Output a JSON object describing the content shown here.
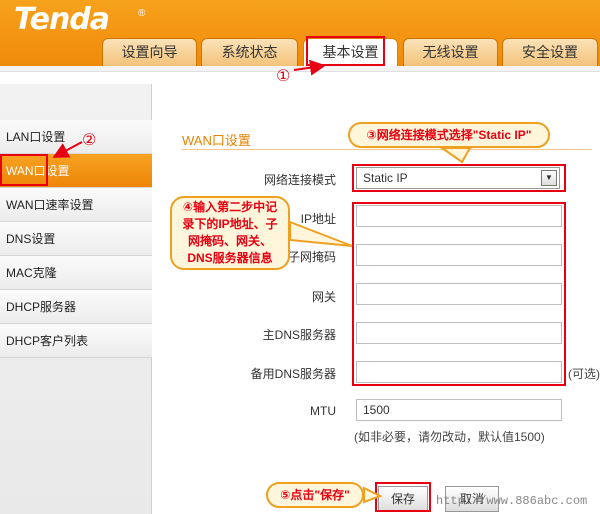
{
  "brand": {
    "logo": "Tenda",
    "reg": "®",
    "accent": "#f08a0a",
    "highlight": "#e60012"
  },
  "tabs": [
    {
      "label": "设置向导"
    },
    {
      "label": "系统状态"
    },
    {
      "label": "基本设置"
    },
    {
      "label": "无线设置"
    },
    {
      "label": "安全设置"
    }
  ],
  "sidebar": {
    "items": [
      {
        "label": "LAN口设置"
      },
      {
        "label": "WAN口设置"
      },
      {
        "label": "WAN口速率设置"
      },
      {
        "label": "DNS设置"
      },
      {
        "label": "MAC克隆"
      },
      {
        "label": "DHCP服务器"
      },
      {
        "label": "DHCP客户列表"
      }
    ]
  },
  "main": {
    "title": "WAN口设置",
    "mode_label": "网络连接模式",
    "mode_value": "Static IP",
    "ip_label": "IP地址",
    "mask_label": "子网掩码",
    "gateway_label": "网关",
    "dns1_label": "主DNS服务器",
    "dns2_label": "备用DNS服务器",
    "optional": "(可选)",
    "mtu_label": "MTU",
    "mtu_value": "1500",
    "mtu_hint": "(如非必要，请勿改动，默认值1500)",
    "save_label": "保存",
    "cancel_label": "取消"
  },
  "annotations": {
    "step1": "①",
    "step2": "②",
    "step3": "③网络连接模式选择\"Static IP\"",
    "step4_line1": "④输入第二步中记",
    "step4_line2": "录下的IP地址、子",
    "step4_line3": "网掩码、网关、",
    "step4_line4": "DNS服务器信息",
    "step5": "⑤点击\"保存\"",
    "watermark": "http://www.886abc.com"
  }
}
